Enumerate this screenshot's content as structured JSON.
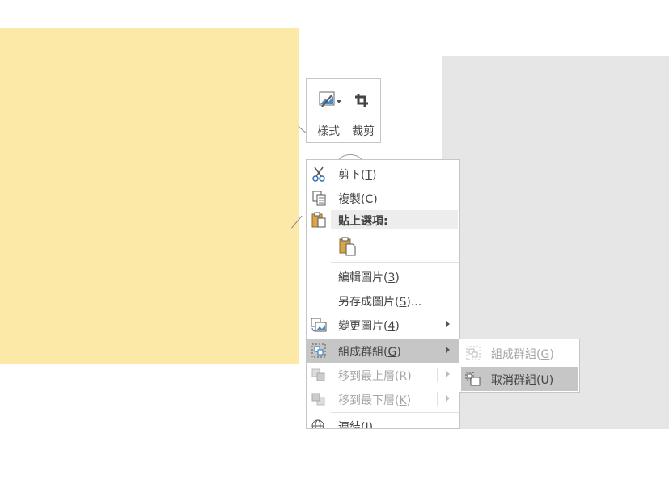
{
  "toolbar": {
    "style_label": "樣式",
    "crop_label": "裁剪"
  },
  "menu": {
    "cut": {
      "text": "剪下(",
      "key": "T",
      "tail": ")"
    },
    "copy": {
      "text": "複製(",
      "key": "C",
      "tail": ")"
    },
    "paste_header": "貼上選項:",
    "edit_picture": {
      "text": "編輯圖片(",
      "key": "3",
      "tail": ")"
    },
    "save_as_picture": {
      "text": "另存成圖片(",
      "key": "S",
      "tail": ")..."
    },
    "change_picture": {
      "text": "變更圖片(",
      "key": "4",
      "tail": ")"
    },
    "group": {
      "text": "組成群組(",
      "key": "G",
      "tail": ")"
    },
    "bring_to_front": {
      "text": "移到最上層(",
      "key": "R",
      "tail": ")"
    },
    "send_to_back": {
      "text": "移到最下層(",
      "key": "K",
      "tail": ")"
    },
    "link": {
      "text": "連結(",
      "key": "I",
      "tail": ")"
    }
  },
  "submenu": {
    "group": {
      "text": "組成群組(",
      "key": "G",
      "tail": ")"
    },
    "ungroup": {
      "text": "取消群組(",
      "key": "U",
      "tail": ")"
    }
  },
  "colors": {
    "shape_fill": "#fce9a7",
    "highlight": "#c6c6c6",
    "disabled_text": "#a6a6a6"
  }
}
